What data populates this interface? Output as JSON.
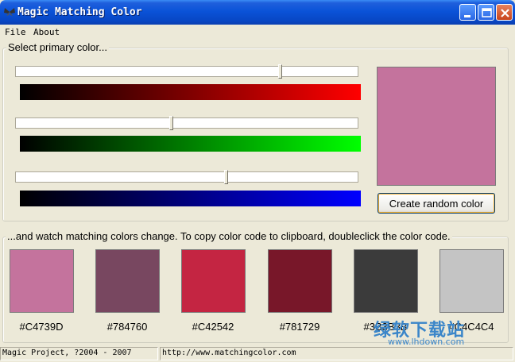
{
  "window": {
    "title": "Magic Matching Color",
    "controls": {
      "minimize": "minimize-icon",
      "maximize": "maximize-icon",
      "close": "close-icon"
    }
  },
  "menu": {
    "items": [
      "File",
      "About"
    ]
  },
  "primary": {
    "legend": "Select primary color...",
    "sliders": [
      {
        "channel": "red",
        "value": 0.773,
        "gradient_to": "#FF0000"
      },
      {
        "channel": "green",
        "value": 0.455,
        "gradient_to": "#00FF00"
      },
      {
        "channel": "blue",
        "value": 0.616,
        "gradient_to": "#0000FF"
      }
    ],
    "preview_color": "#C4739D",
    "random_button": "Create random color"
  },
  "matching": {
    "legend": "...and watch matching colors change. To copy color code to clipboard, doubleclick the color code.",
    "swatches": [
      {
        "color": "#C4739D",
        "code": "#C4739D"
      },
      {
        "color": "#784760",
        "code": "#784760"
      },
      {
        "color": "#C42542",
        "code": "#C42542"
      },
      {
        "color": "#781729",
        "code": "#781729"
      },
      {
        "color": "#3B3B3B",
        "code": "#3B3B3B"
      },
      {
        "color": "#C4C4C4",
        "code": "#C4C4C4"
      }
    ]
  },
  "status": {
    "copyright": "Magic Project, ?2004 - 2007",
    "url": "http://www.matchingcolor.com"
  },
  "watermark": {
    "text": "绿软下载站",
    "url": "www.lhdown.com"
  }
}
